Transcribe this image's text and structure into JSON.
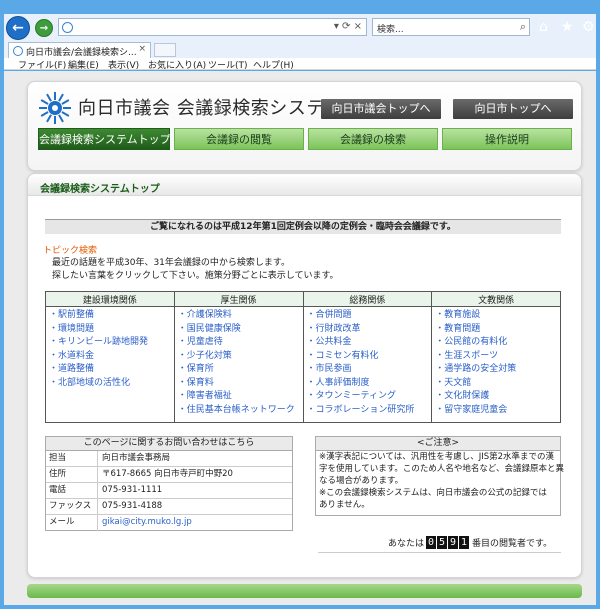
{
  "browser": {
    "search_placeholder": "検索...",
    "tab_title": "向日市議会/会議録検索シ...",
    "menu": [
      {
        "label": "ファイル(F)"
      },
      {
        "label": "編集(E)"
      },
      {
        "label": "表示(V)"
      },
      {
        "label": "お気に入り(A)"
      },
      {
        "label": "ツール(T)"
      },
      {
        "label": "ヘルプ(H)"
      }
    ]
  },
  "header": {
    "site_title": "向日市議会 会議録検索システム",
    "links": {
      "council_top": "向日市議会トップへ",
      "city_top": "向日市トップへ"
    },
    "nav": {
      "top": "会議録検索システムトップ",
      "browse": "会議録の閲覧",
      "search": "会議録の検索",
      "guide": "操作説明"
    }
  },
  "content": {
    "title": "会議録検索システムトップ",
    "notice": "ご覧になれるのは平成12年第1回定例会以降の定例会・臨時会会議録です。",
    "topic_heading": "トピック検索",
    "topic_line1": "最近の話題を平成30年、31年会議録の中から検索します。",
    "topic_line2": "探したい言葉をクリックして下さい。施策分野ごとに表示しています。",
    "topics": [
      {
        "header": "建設環境関係",
        "items": [
          "駅前整備",
          "環境問題",
          "キリンビール跡地開発",
          "水道料金",
          "道路整備",
          "北部地域の活性化"
        ]
      },
      {
        "header": "厚生関係",
        "items": [
          "介護保険料",
          "国民健康保険",
          "児童虐待",
          "少子化対策",
          "保育所",
          "保育料",
          "障害者福祉",
          "住民基本台帳ネットワーク"
        ]
      },
      {
        "header": "総務関係",
        "items": [
          "合併問題",
          "行財政改革",
          "公共料金",
          "コミセン有料化",
          "市民参画",
          "人事評価制度",
          "タウンミーティング",
          "コラボレーション研究所"
        ]
      },
      {
        "header": "文教関係",
        "items": [
          "教育施設",
          "教育問題",
          "公民館の有料化",
          "生涯スポーツ",
          "通学路の安全対策",
          "天文館",
          "文化財保護",
          "留守家庭児童会"
        ]
      }
    ],
    "contact": {
      "heading": "このページに関するお問い合わせはこちら",
      "rows": [
        {
          "label": "担当",
          "value": "向日市議会事務局"
        },
        {
          "label": "住所",
          "value": "〒617-8665 向日市寺戸町中野20"
        },
        {
          "label": "電話",
          "value": "075-931-1111"
        },
        {
          "label": "ファックス",
          "value": "075-931-4188"
        },
        {
          "label": "メール",
          "value": "gikai@city.muko.lg.jp"
        }
      ]
    },
    "note": {
      "heading": "<ご注意>",
      "lines": [
        "※漢字表記については、汎用性を考慮し、JIS第2水準までの漢",
        "字を使用しています。このため人名や地名など、会議録原本と異",
        "なる場合があります。",
        "※この会議録検索システムは、向日市議会の公式の記録では",
        "ありません。"
      ]
    },
    "counter": {
      "prefix": "あなたは",
      "digits": [
        "0",
        "5",
        "9",
        "1"
      ],
      "suffix": "番目の閲覧者です。"
    }
  }
}
